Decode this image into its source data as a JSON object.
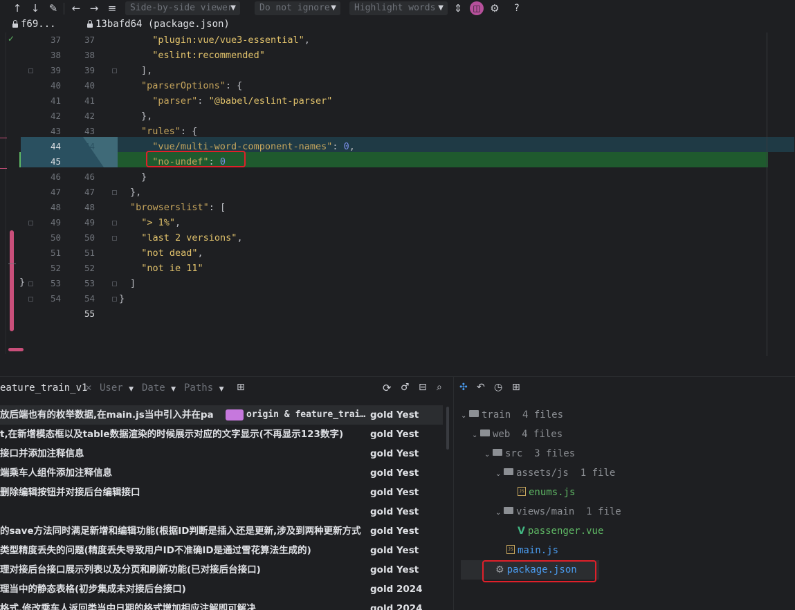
{
  "toolbar": {
    "viewer_label": "Side-by-side viewer",
    "ignore_label": "Do not ignore",
    "highlight_label": "Highlight words",
    "help_label": "?"
  },
  "header": {
    "left_rev": "f69...",
    "right_title": "13bafd64 (package.json)"
  },
  "code_lines": [
    {
      "l": "37",
      "r": "37",
      "text": "  \"plugin:vue/vue3-essential\","
    },
    {
      "l": "38",
      "r": "38",
      "text": "  \"eslint:recommended\""
    },
    {
      "l": "39",
      "r": "39",
      "text": "],"
    },
    {
      "l": "40",
      "r": "40",
      "text": "\"parserOptions\": {"
    },
    {
      "l": "41",
      "r": "41",
      "text": "  \"parser\": \"@babel/eslint-parser\""
    },
    {
      "l": "42",
      "r": "42",
      "text": "},"
    },
    {
      "l": "43",
      "r": "43",
      "text": "\"rules\": {"
    },
    {
      "l": "44",
      "r": "44",
      "text": "  \"vue/multi-word-component-names\": 0,"
    },
    {
      "l": "45",
      "r": "45",
      "text": "  \"no-undef\": 0"
    },
    {
      "l": "46",
      "r": "46",
      "text": "}"
    },
    {
      "l": "47",
      "r": "47",
      "text": "},"
    },
    {
      "l": "48",
      "r": "48",
      "text": "\"browserslist\": ["
    },
    {
      "l": "49",
      "r": "49",
      "text": "  \"> 1%\","
    },
    {
      "l": "50",
      "r": "50",
      "text": "  \"last 2 versions\","
    },
    {
      "l": "51",
      "r": "51",
      "text": "  \"not dead\","
    },
    {
      "l": "52",
      "r": "52",
      "text": "  \"not ie 11\""
    },
    {
      "l": "53",
      "r": "53",
      "text": "]"
    },
    {
      "l": "54",
      "r": "54",
      "text": "}"
    },
    {
      "l": "",
      "r": "55",
      "text": ""
    }
  ],
  "left_brace": "}",
  "log": {
    "branch": "eature_train_v1",
    "filters": {
      "user": "User",
      "date": "Date",
      "paths": "Paths"
    },
    "tag_text": "origin & feature_trai…",
    "commits": [
      {
        "msg": "放后端也有的枚举数据,在main.js当中引入并在pa",
        "author": "gold",
        "date": "Yest"
      },
      {
        "msg": "t,在新增模态框以及table数据渲染的时候展示对应的文字显示(不再显示123数字)",
        "author": "gold",
        "date": "Yest"
      },
      {
        "msg": "接口并添加注释信息",
        "author": "gold",
        "date": "Yest"
      },
      {
        "msg": "端乘车人组件添加注释信息",
        "author": "gold",
        "date": "Yest"
      },
      {
        "msg": "删除编辑按钮并对接后台编辑接口",
        "author": "gold",
        "date": "Yest"
      },
      {
        "msg": "",
        "author": "gold",
        "date": "Yest"
      },
      {
        "msg": "的save方法同时满足新增和编辑功能(根据ID判断是插入还是更新,涉及到两种更新方式",
        "author": "gold",
        "date": "Yest"
      },
      {
        "msg": "类型精度丢失的问题(精度丢失导致用户ID不准确ID是通过雪花算法生成的)",
        "author": "gold",
        "date": "Yest"
      },
      {
        "msg": "理对接后台接口展示列表以及分页和刷新功能(已对接后台接口)",
        "author": "gold",
        "date": "Yest"
      },
      {
        "msg": "理当中的静态表格(初步集成未对接后台接口)",
        "author": "gold",
        "date": "2024"
      },
      {
        "msg": "格式,修改乘车人返回类当中日期的格式增加相应注解即可解决",
        "author": "gold",
        "date": "2024"
      }
    ]
  },
  "tree": {
    "train": {
      "name": "train",
      "count": "4 files"
    },
    "web": {
      "name": "web",
      "count": "4 files"
    },
    "src": {
      "name": "src",
      "count": "3 files"
    },
    "assets": {
      "name": "assets/js",
      "count": "1 file"
    },
    "enums": {
      "name": "enums.js"
    },
    "views": {
      "name": "views/main",
      "count": "1 file"
    },
    "passenger": {
      "name": "passenger.vue"
    },
    "main": {
      "name": "main.js"
    },
    "package": {
      "name": "package.json"
    }
  },
  "colors": {
    "bg": "#1e1f22",
    "added": "#1f5a2e",
    "modified": "#1f3a45",
    "highlight_box": "#e0202a",
    "string": "#e2c36c",
    "number": "#7a8fe8",
    "vcs_added": "#5fb865",
    "tag": "#c678dd"
  }
}
